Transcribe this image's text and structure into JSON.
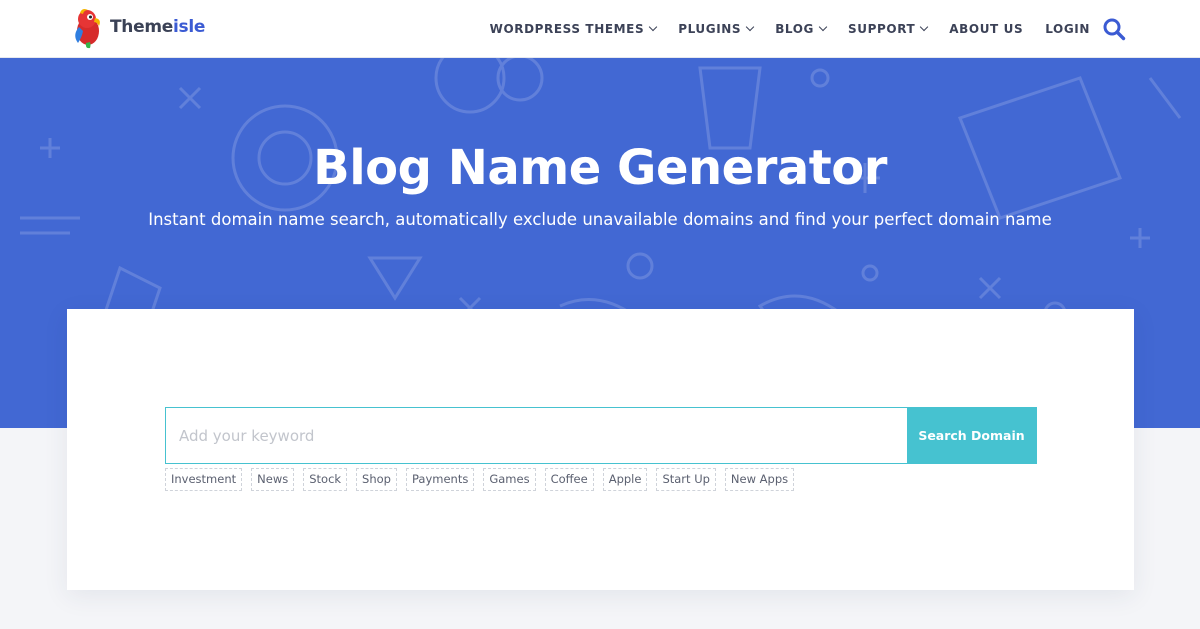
{
  "brand": {
    "name_part1": "Theme",
    "name_part2": "isle"
  },
  "nav": {
    "items": [
      {
        "label": "WORDPRESS THEMES",
        "has_dropdown": true
      },
      {
        "label": "PLUGINS",
        "has_dropdown": true
      },
      {
        "label": "BLOG",
        "has_dropdown": true
      },
      {
        "label": "SUPPORT",
        "has_dropdown": true
      },
      {
        "label": "ABOUT US",
        "has_dropdown": false
      },
      {
        "label": "LOGIN",
        "has_dropdown": false
      }
    ],
    "search_icon": "search-icon"
  },
  "hero": {
    "title": "Blog Name Generator",
    "subtitle": "Instant domain name search, automatically exclude unavailable domains and find your perfect domain name"
  },
  "search": {
    "placeholder": "Add your keyword",
    "value": "",
    "button_label": "Search Domain"
  },
  "tags": [
    "Investment",
    "News",
    "Stock",
    "Shop",
    "Payments",
    "Games",
    "Coffee",
    "Apple",
    "Start Up",
    "New Apps"
  ],
  "colors": {
    "hero_bg": "#4268d3",
    "accent": "#46c2d0",
    "brand_blue": "#3b5bd3",
    "nav_text": "#3c4257"
  }
}
